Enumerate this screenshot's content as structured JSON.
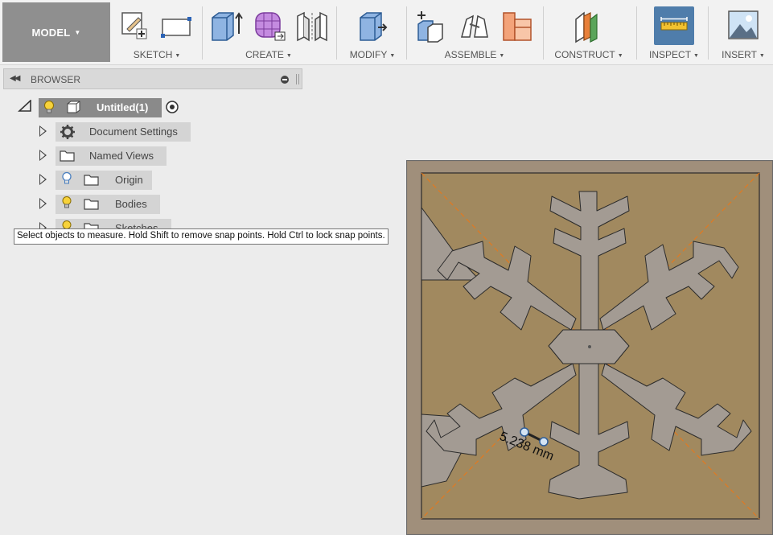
{
  "toolbar": {
    "model_label": "MODEL",
    "groups": {
      "sketch": "SKETCH",
      "create": "CREATE",
      "modify": "MODIFY",
      "assemble": "ASSEMBLE",
      "construct": "CONSTRUCT",
      "inspect": "INSPECT",
      "insert": "INSERT"
    },
    "icons": [
      "create-sketch-icon",
      "rectangle-icon",
      "extrude-icon",
      "form-icon",
      "mirror-icon",
      "press-pull-icon",
      "new-component-icon",
      "joint-icon",
      "rigid-group-icon",
      "offset-plane-icon",
      "measure-icon",
      "insert-image-icon"
    ],
    "active_tool": "measure"
  },
  "browser": {
    "title": "BROWSER",
    "root": "Untitled(1)",
    "items": [
      {
        "label": "Document Settings",
        "icon": "gear-icon"
      },
      {
        "label": "Named Views",
        "icon": "folder-icon"
      },
      {
        "label": "Origin",
        "icon": "folder-icon",
        "bulb": true
      },
      {
        "label": "Bodies",
        "icon": "folder-icon",
        "bulb": true
      },
      {
        "label": "Sketches",
        "icon": "folder-icon",
        "bulb": true
      }
    ]
  },
  "tooltip": "Select objects to measure. Hold Shift to remove snap points. Hold Ctrl to lock snap points.",
  "viewport": {
    "measurement": "5.238 mm",
    "colors": {
      "plate": "#9e8766",
      "snowflake": "#a39b93",
      "dashed_guides": "#e07a22",
      "background": "#9a8a78"
    }
  }
}
